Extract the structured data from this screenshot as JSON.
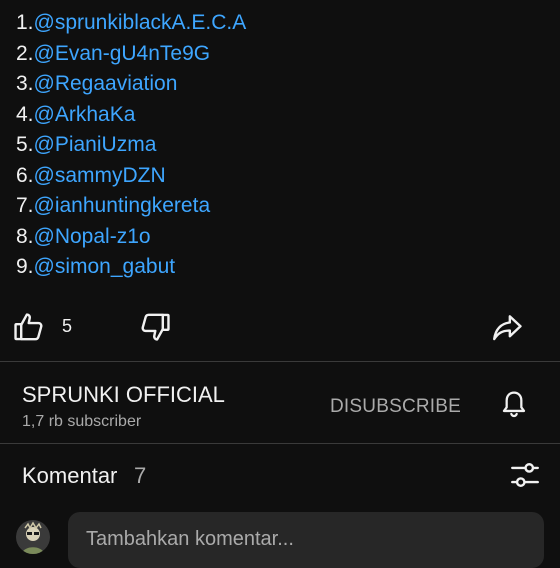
{
  "mentions": [
    {
      "num": "1.",
      "handle": "@sprunkiblackA.E.C.A"
    },
    {
      "num": "2.",
      "handle": "@Evan-gU4nTe9G"
    },
    {
      "num": "3.",
      "handle": "@Regaaviation"
    },
    {
      "num": "4.",
      "handle": "@ArkhaKa"
    },
    {
      "num": "5.",
      "handle": "@PianiUzma"
    },
    {
      "num": "6.",
      "handle": "@sammyDZN"
    },
    {
      "num": "7.",
      "handle": "@ianhuntingkereta"
    },
    {
      "num": "8.",
      "handle": "@Nopal-z1o"
    },
    {
      "num": "9.",
      "handle": "@simon_gabut"
    }
  ],
  "actions": {
    "like_count": "5",
    "like_icon": "thumbs-up-icon",
    "dislike_icon": "thumbs-down-icon",
    "share_icon": "share-icon"
  },
  "channel": {
    "name": "SPRUNKI OFFICIAL",
    "subscribers": "1,7 rb subscriber",
    "subscribe_label": "DISUBSCRIBE",
    "bell_icon": "bell-icon"
  },
  "comments": {
    "title": "Komentar",
    "count": "7",
    "filter_icon": "sliders-icon",
    "placeholder": "Tambahkan komentar..."
  },
  "colors": {
    "background": "#0f0f0f",
    "link": "#3ea6ff",
    "text": "#f1f1f1",
    "secondary": "#aaaaaa"
  }
}
